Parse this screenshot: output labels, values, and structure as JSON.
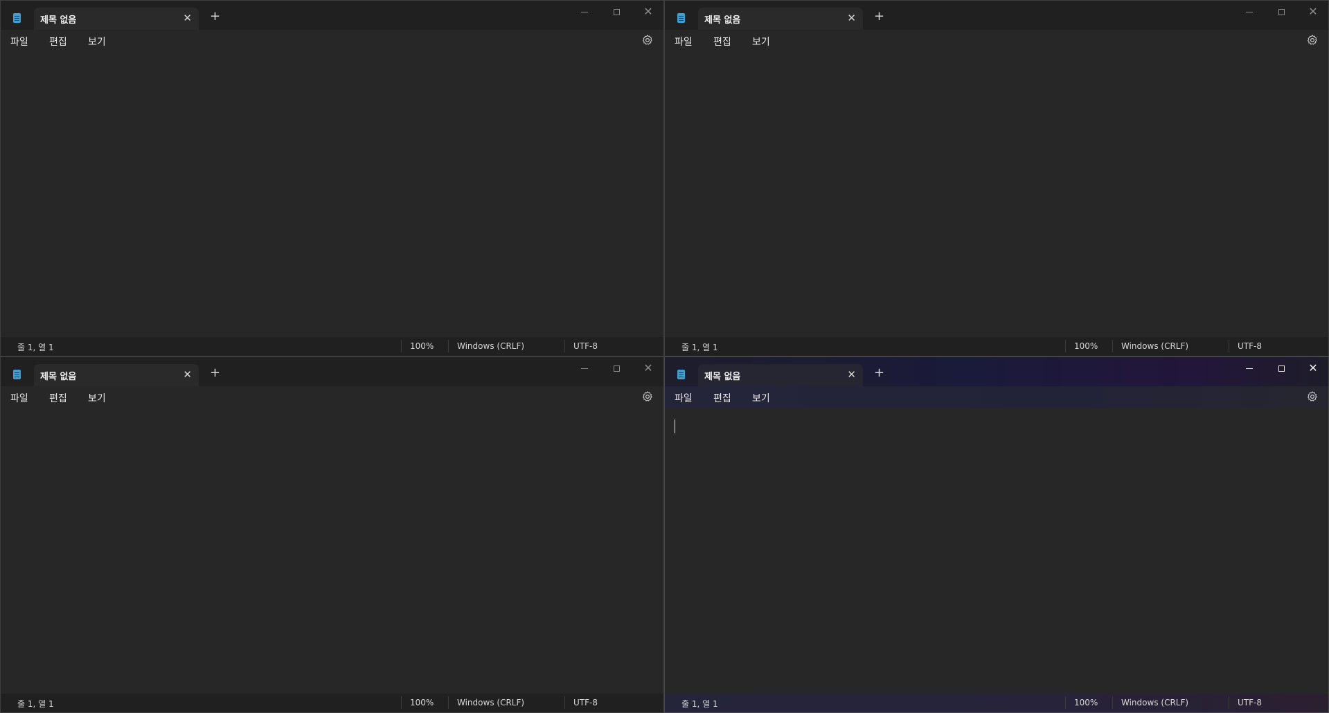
{
  "windows": [
    {
      "tab_title": "제목 없음",
      "tab_close": "✕",
      "tab_add": "+",
      "menu": {
        "file": "파일",
        "edit": "편집",
        "view": "보기"
      },
      "status": {
        "position": "줄 1, 열 1",
        "zoom": "100%",
        "line_ending": "Windows (CRLF)",
        "encoding": "UTF-8"
      },
      "active": false
    },
    {
      "tab_title": "제목 없음",
      "tab_close": "✕",
      "tab_add": "+",
      "menu": {
        "file": "파일",
        "edit": "편집",
        "view": "보기"
      },
      "status": {
        "position": "줄 1, 열 1",
        "zoom": "100%",
        "line_ending": "Windows (CRLF)",
        "encoding": "UTF-8"
      },
      "active": false
    },
    {
      "tab_title": "제목 없음",
      "tab_close": "✕",
      "tab_add": "+",
      "menu": {
        "file": "파일",
        "edit": "편집",
        "view": "보기"
      },
      "status": {
        "position": "줄 1, 열 1",
        "zoom": "100%",
        "line_ending": "Windows (CRLF)",
        "encoding": "UTF-8"
      },
      "active": false
    },
    {
      "tab_title": "제목 없음",
      "tab_close": "✕",
      "tab_add": "+",
      "menu": {
        "file": "파일",
        "edit": "편집",
        "view": "보기"
      },
      "status": {
        "position": "줄 1, 열 1",
        "zoom": "100%",
        "line_ending": "Windows (CRLF)",
        "encoding": "UTF-8"
      },
      "active": true
    }
  ],
  "icons": {
    "app": "notepad-icon",
    "minimize": "minimize-icon",
    "maximize": "maximize-icon",
    "close": "close-icon",
    "settings": "gear-icon"
  },
  "colors": {
    "background": "#272727",
    "titlebar": "#202020",
    "app_icon": "#3aa0d6",
    "active_tint": "#1a1a3a"
  }
}
